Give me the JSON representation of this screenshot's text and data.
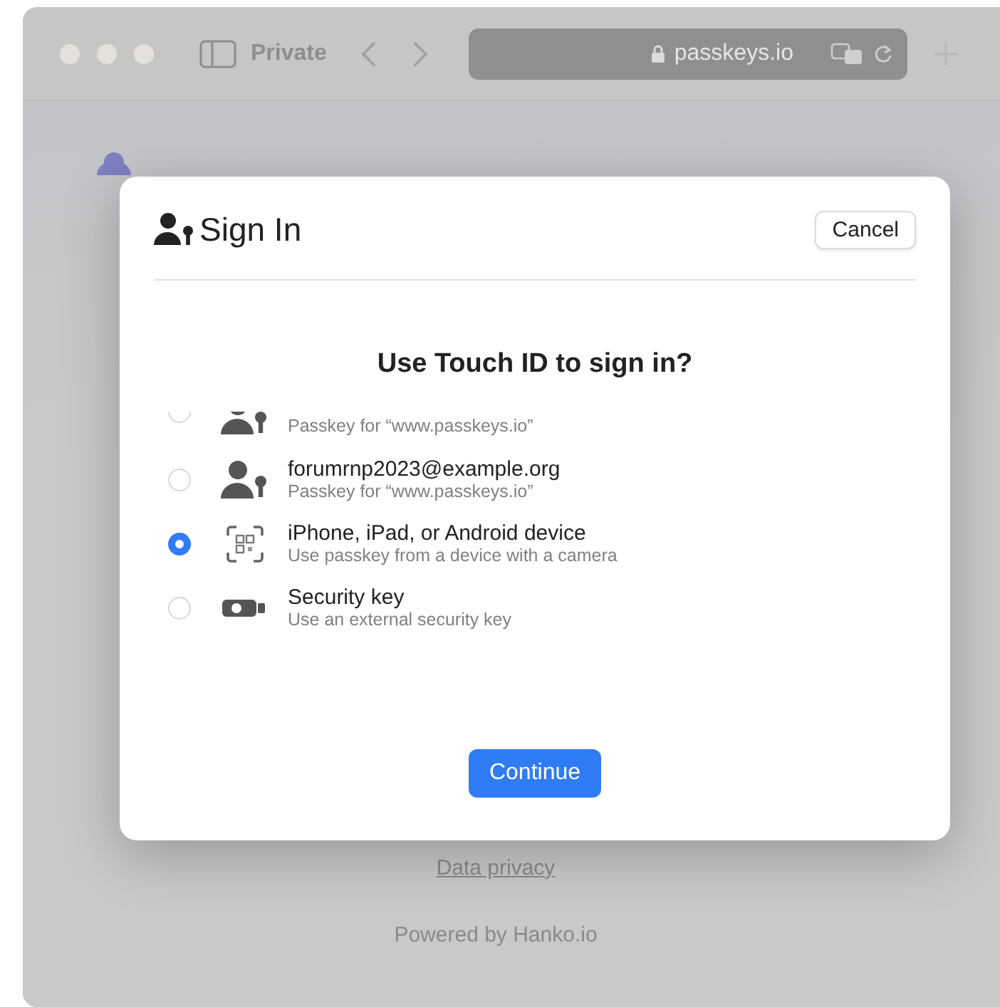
{
  "toolbar": {
    "tab_label": "Private",
    "address": "passkeys.io"
  },
  "dialog": {
    "title": "Sign In",
    "cancel": "Cancel",
    "heading": "Use Touch ID to sign in?",
    "options": [
      {
        "kind": "passkey",
        "subtitle": "Passkey for “www.passkeys.io”",
        "selected": false,
        "partial": true
      },
      {
        "kind": "passkey",
        "title": "forumrnp2023@example.org",
        "subtitle": "Passkey for “www.passkeys.io”",
        "selected": false
      },
      {
        "kind": "device",
        "title": "iPhone, iPad, or Android device",
        "subtitle": "Use passkey from a device with a camera",
        "selected": true
      },
      {
        "kind": "security-key",
        "title": "Security key",
        "subtitle": "Use an external security key",
        "selected": false
      }
    ],
    "continue": "Continue"
  },
  "footer": {
    "link": "Data privacy",
    "powered": "Powered by Hanko.io"
  }
}
